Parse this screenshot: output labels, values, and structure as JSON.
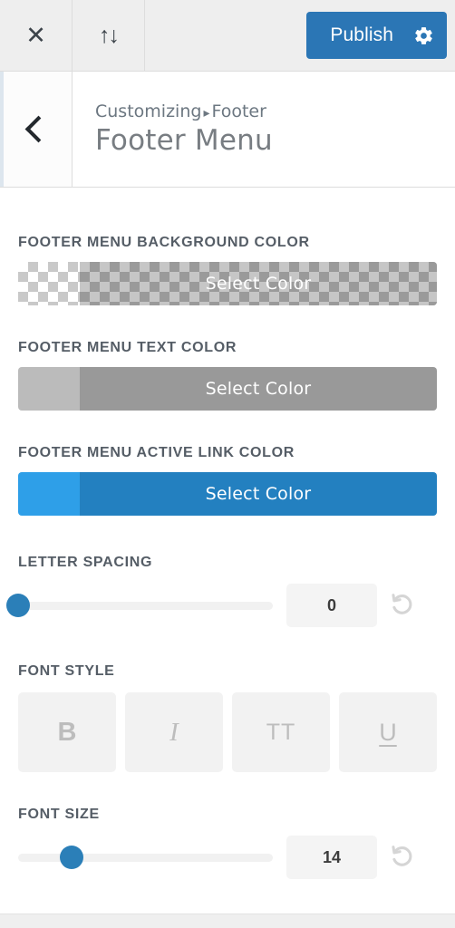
{
  "header": {
    "close_icon": "close-icon",
    "devices_icon": "up-down-arrows-icon",
    "publish_label": "Publish",
    "gear_icon": "gear-icon",
    "publish_color": "#2b76b5"
  },
  "titlebar": {
    "back_icon": "chevron-left-icon",
    "breadcrumb_root": "Customizing",
    "breadcrumb_separator": "▸",
    "breadcrumb_current": "Footer",
    "title": "Footer Menu"
  },
  "controls": {
    "background_color": {
      "label": "FOOTER MENU BACKGROUND COLOR",
      "button_label": "Select Color",
      "value": "transparent",
      "swatch_style": "checkerboard"
    },
    "text_color": {
      "label": "FOOTER MENU TEXT COLOR",
      "button_label": "Select Color",
      "chip_color": "#bbbbbb",
      "body_color": "#999999"
    },
    "active_link_color": {
      "label": "FOOTER MENU ACTIVE LINK COLOR",
      "button_label": "Select Color",
      "chip_color": "#2e9fe8",
      "body_color": "#2380c0"
    },
    "letter_spacing": {
      "label": "LETTER SPACING",
      "value": "0",
      "handle_percent": 0,
      "reset_icon": "reset-arrow-icon"
    },
    "font_style": {
      "label": "FONT STYLE",
      "buttons": [
        {
          "name": "bold",
          "glyph": "B"
        },
        {
          "name": "italic",
          "glyph": "I"
        },
        {
          "name": "uppercase",
          "glyph": "TT"
        },
        {
          "name": "underline",
          "glyph": "U"
        }
      ]
    },
    "font_size": {
      "label": "FONT SIZE",
      "value": "14",
      "handle_percent": 21,
      "reset_icon": "reset-arrow-icon"
    }
  }
}
